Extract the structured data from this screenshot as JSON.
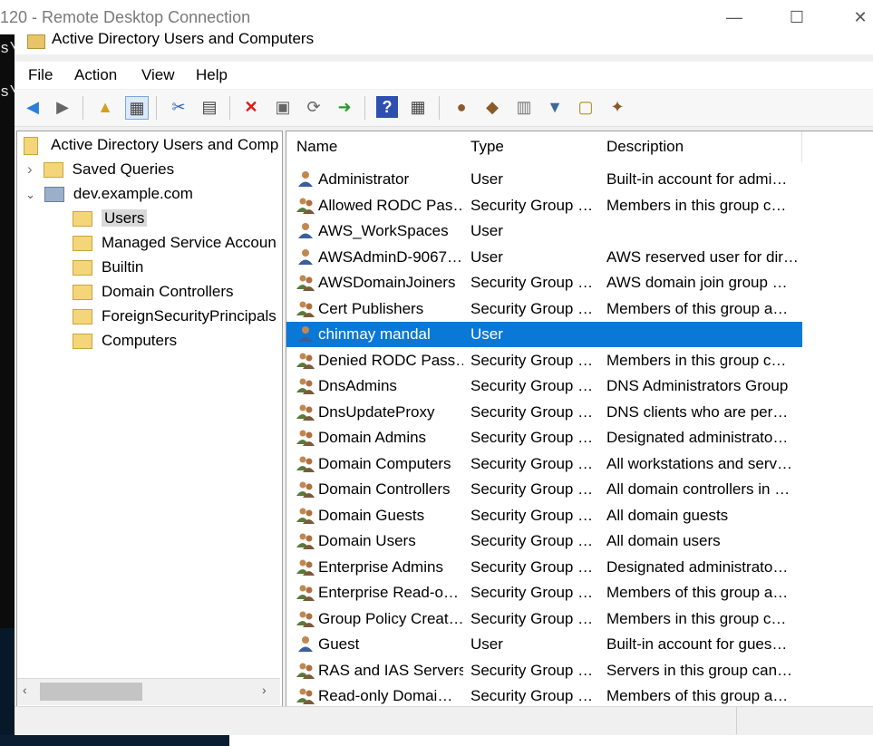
{
  "rdp": {
    "title": "120 - Remote Desktop Connection",
    "minimize": "—",
    "maximize": "☐",
    "close": "✕"
  },
  "terminal": {
    "line1": "s\\",
    "line2": "s\\"
  },
  "mmc": {
    "title": "Active Directory Users and Computers"
  },
  "menu": [
    "File",
    "Action",
    "View",
    "Help"
  ],
  "tree": {
    "root": "Active Directory Users and Comp",
    "saved_queries": "Saved Queries",
    "domain": "dev.example.com",
    "children": [
      "Users",
      "Managed Service Accoun",
      "Builtin",
      "Domain Controllers",
      "ForeignSecurityPrincipals",
      "Computers"
    ]
  },
  "list": {
    "columns": [
      "Name",
      "Type",
      "Description"
    ],
    "rows": [
      {
        "name": "Administrator",
        "type": "User",
        "description": "Built-in account for admi…"
      },
      {
        "name": "Allowed RODC Pas…",
        "type": "Security Group …",
        "description": "Members in this group c…"
      },
      {
        "name": "AWS_WorkSpaces",
        "type": "User",
        "description": ""
      },
      {
        "name": "AWSAdminD-9067…",
        "type": "User",
        "description": "AWS reserved user for dir…"
      },
      {
        "name": "AWSDomainJoiners",
        "type": "Security Group …",
        "description": "AWS domain join group …"
      },
      {
        "name": "Cert Publishers",
        "type": "Security Group …",
        "description": "Members of this group a…"
      },
      {
        "name": "chinmay mandal",
        "type": "User",
        "description": ""
      },
      {
        "name": "Denied RODC Pass…",
        "type": "Security Group …",
        "description": "Members in this group c…"
      },
      {
        "name": "DnsAdmins",
        "type": "Security Group …",
        "description": "DNS Administrators Group"
      },
      {
        "name": "DnsUpdateProxy",
        "type": "Security Group …",
        "description": "DNS clients who are per…"
      },
      {
        "name": "Domain Admins",
        "type": "Security Group …",
        "description": "Designated administrato…"
      },
      {
        "name": "Domain Computers",
        "type": "Security Group …",
        "description": "All workstations and serv…"
      },
      {
        "name": "Domain Controllers",
        "type": "Security Group …",
        "description": "All domain controllers in …"
      },
      {
        "name": "Domain Guests",
        "type": "Security Group …",
        "description": "All domain guests"
      },
      {
        "name": "Domain Users",
        "type": "Security Group …",
        "description": "All domain users"
      },
      {
        "name": "Enterprise Admins",
        "type": "Security Group …",
        "description": "Designated administrato…"
      },
      {
        "name": "Enterprise Read-o…",
        "type": "Security Group …",
        "description": "Members of this group a…"
      },
      {
        "name": "Group Policy Creat…",
        "type": "Security Group …",
        "description": "Members in this group c…"
      },
      {
        "name": "Guest",
        "type": "User",
        "description": "Built-in account for gues…"
      },
      {
        "name": "RAS and IAS Servers",
        "type": "Security Group …",
        "description": "Servers in this group can…"
      },
      {
        "name": "Read-only Domai…",
        "type": "Security Group …",
        "description": "Members of this group a…"
      }
    ]
  },
  "colors": {
    "selection": "#0a78d7",
    "folder": "#f5d57a"
  }
}
